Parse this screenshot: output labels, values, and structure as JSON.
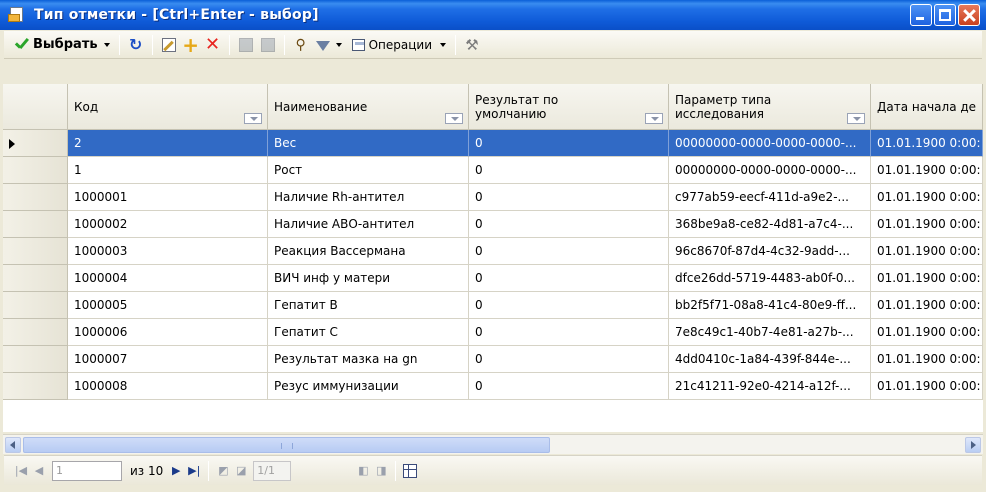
{
  "window": {
    "title": "Тип отметки - [Ctrl+Enter - выбор]"
  },
  "toolbar": {
    "select_label": "Выбрать",
    "operations_label": "Операции",
    "icons": [
      "refresh-icon",
      "edit-icon",
      "add-icon",
      "delete-icon",
      "save-icon",
      "save-all-icon",
      "find-icon",
      "filter-icon",
      "tools-icon"
    ]
  },
  "grid": {
    "columns": [
      {
        "key": "code",
        "label": "Код"
      },
      {
        "key": "name",
        "label": "Наименование"
      },
      {
        "key": "default",
        "label": "Результат по умолчанию"
      },
      {
        "key": "param",
        "label": "Параметр типа исследования"
      },
      {
        "key": "start",
        "label": "Дата начала де"
      }
    ],
    "rows": [
      {
        "code": "2",
        "name": "Вес",
        "default": "0",
        "param": "00000000-0000-0000-0000-...",
        "start": "01.01.1900 0:00:"
      },
      {
        "code": "1",
        "name": "Рост",
        "default": "0",
        "param": "00000000-0000-0000-0000-...",
        "start": "01.01.1900 0:00:"
      },
      {
        "code": "1000001",
        "name": "Наличие Rh-антител",
        "default": "0",
        "param": "c977ab59-eecf-411d-a9e2-...",
        "start": "01.01.1900 0:00:"
      },
      {
        "code": "1000002",
        "name": "Наличие АВО-антител",
        "default": "0",
        "param": "368be9a8-ce82-4d81-a7c4-...",
        "start": "01.01.1900 0:00:"
      },
      {
        "code": "1000003",
        "name": "Реакция Вассермана",
        "default": "0",
        "param": "96c8670f-87d4-4c32-9add-...",
        "start": "01.01.1900 0:00:"
      },
      {
        "code": "1000004",
        "name": "ВИЧ инф у матери",
        "default": "0",
        "param": "dfce26dd-5719-4483-ab0f-0...",
        "start": "01.01.1900 0:00:"
      },
      {
        "code": "1000005",
        "name": "Гепатит В",
        "default": "0",
        "param": "bb2f5f71-08a8-41c4-80e9-ff...",
        "start": "01.01.1900 0:00:"
      },
      {
        "code": "1000006",
        "name": "Гепатит С",
        "default": "0",
        "param": "7e8c49c1-40b7-4e81-a27b-...",
        "start": "01.01.1900 0:00:"
      },
      {
        "code": "1000007",
        "name": "Результат мазка на gn",
        "default": "0",
        "param": "4dd0410c-1a84-439f-844e-...",
        "start": "01.01.1900 0:00:"
      },
      {
        "code": "1000008",
        "name": "Резус иммунизации",
        "default": "0",
        "param": "21c41211-92e0-4214-a12f-...",
        "start": "01.01.1900 0:00:"
      }
    ]
  },
  "navigator": {
    "position_value": "1",
    "count_text": "из 10",
    "page_value": "1/1"
  },
  "colors": {
    "selection": "#316ac5",
    "titlebar": "#0f5bd8"
  }
}
